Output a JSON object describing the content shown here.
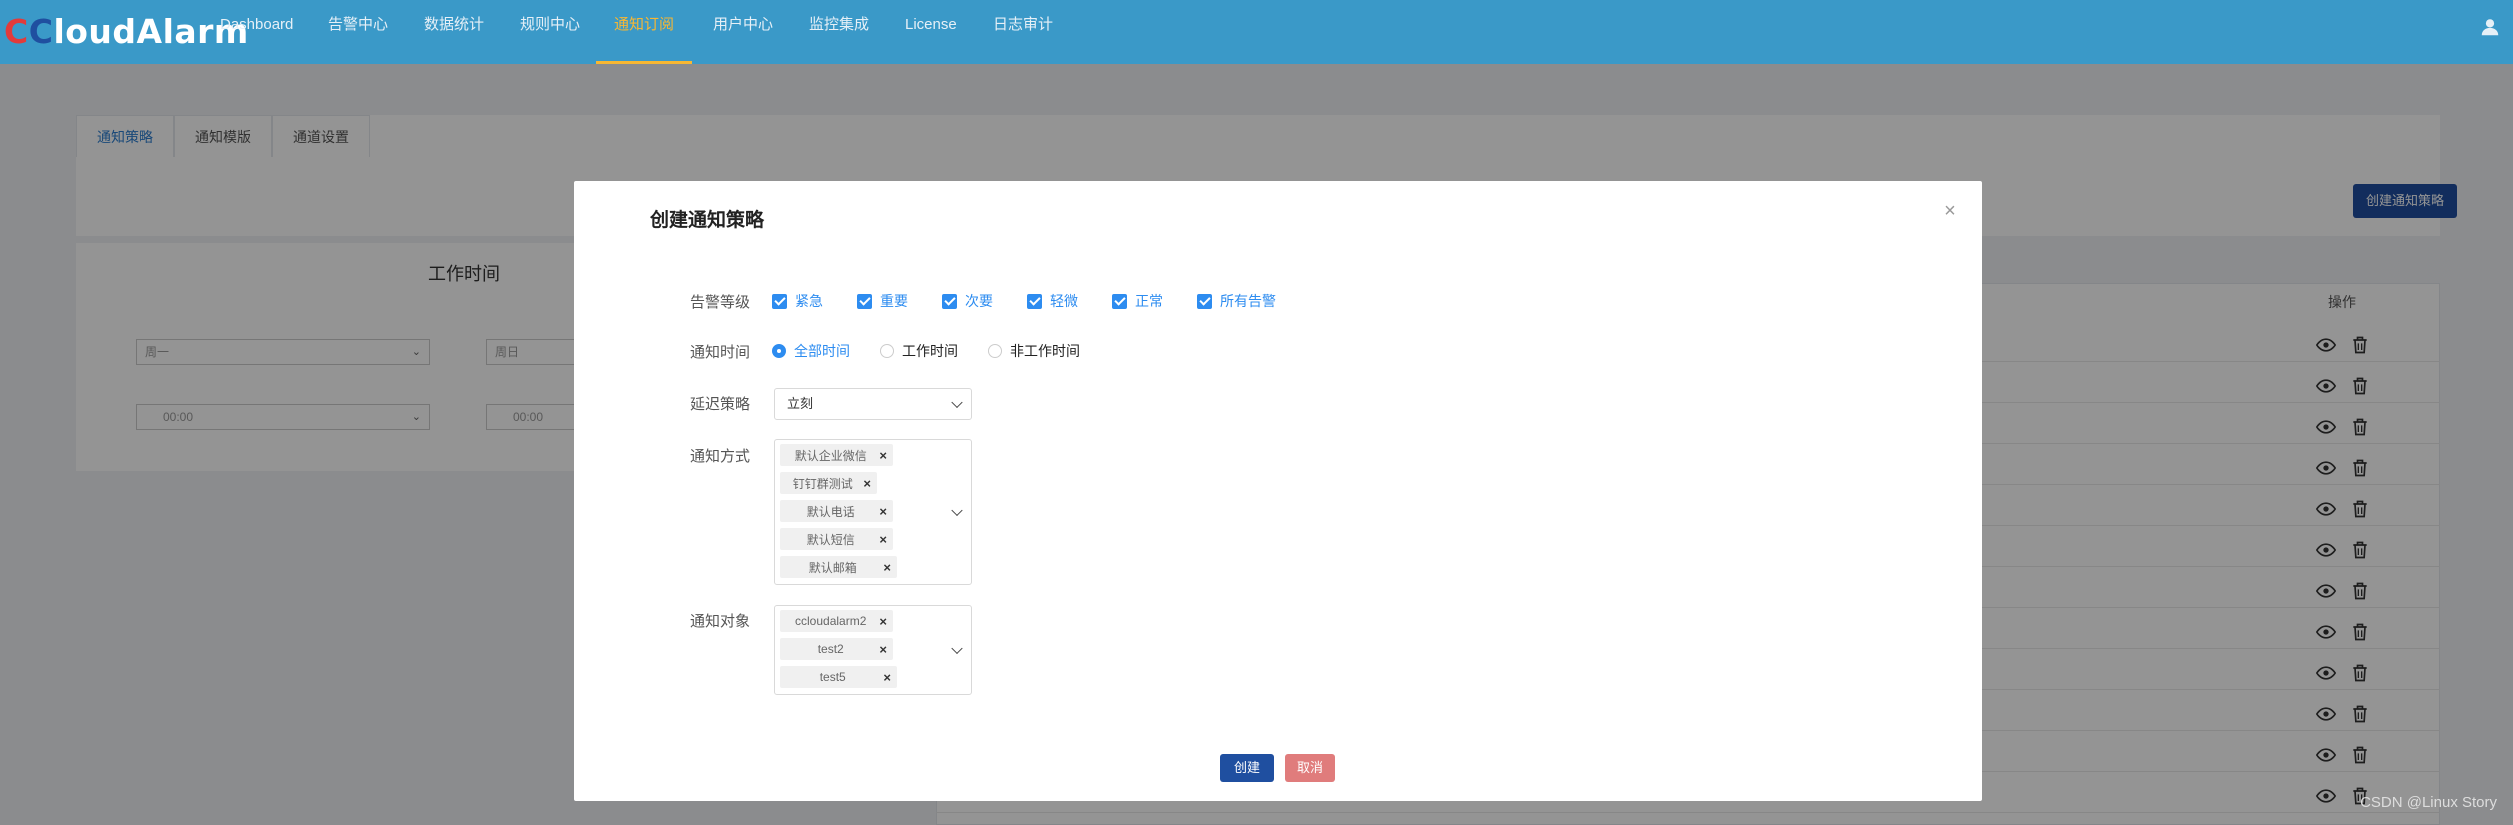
{
  "app": {
    "logo_prefix_1": "C",
    "logo_prefix_2": "C",
    "logo_rest": "loudAlarm"
  },
  "nav": [
    {
      "label": "Dashboard",
      "active": false
    },
    {
      "label": "告警中心",
      "active": false
    },
    {
      "label": "数据统计",
      "active": false
    },
    {
      "label": "规则中心",
      "active": false
    },
    {
      "label": "通知订阅",
      "active": true
    },
    {
      "label": "用户中心",
      "active": false
    },
    {
      "label": "监控集成",
      "active": false
    },
    {
      "label": "License",
      "active": false
    },
    {
      "label": "日志审计",
      "active": false
    }
  ],
  "page": {
    "tabs": [
      "通知策略",
      "通知模版",
      "通道设置"
    ],
    "create_policy_button": "创建通知策略",
    "worktime_title": "工作时间",
    "day_start": "周一",
    "day_end": "周日",
    "time_start": "00:00",
    "time_end": "00:00",
    "operations_header": "操作",
    "row_count": 12
  },
  "modal": {
    "title": "创建通知策略",
    "alert_level": {
      "label": "告警等级",
      "options": [
        "紧急",
        "重要",
        "次要",
        "轻微",
        "正常",
        "所有告警"
      ]
    },
    "notify_time": {
      "label": "通知时间",
      "options": [
        "全部时间",
        "工作时间",
        "非工作时间"
      ],
      "selected": "全部时间"
    },
    "delay_policy": {
      "label": "延迟策略",
      "value": "立刻"
    },
    "notify_method": {
      "label": "通知方式",
      "tags": [
        "默认企业微信",
        "钉钉群测试",
        "默认电话",
        "默认短信",
        "默认邮箱"
      ]
    },
    "notify_target": {
      "label": "通知对象",
      "tags": [
        "ccloudalarm2",
        "test2",
        "test5"
      ]
    },
    "create_button": "创建",
    "cancel_button": "取消"
  },
  "watermark": "CSDN @Linux Story",
  "colors": {
    "topbar": "#3a99c8",
    "nav_active": "#f7b733",
    "primary": "#1f4fa0",
    "checkbox": "#2d8cf0",
    "cancel": "#e07c7c"
  }
}
